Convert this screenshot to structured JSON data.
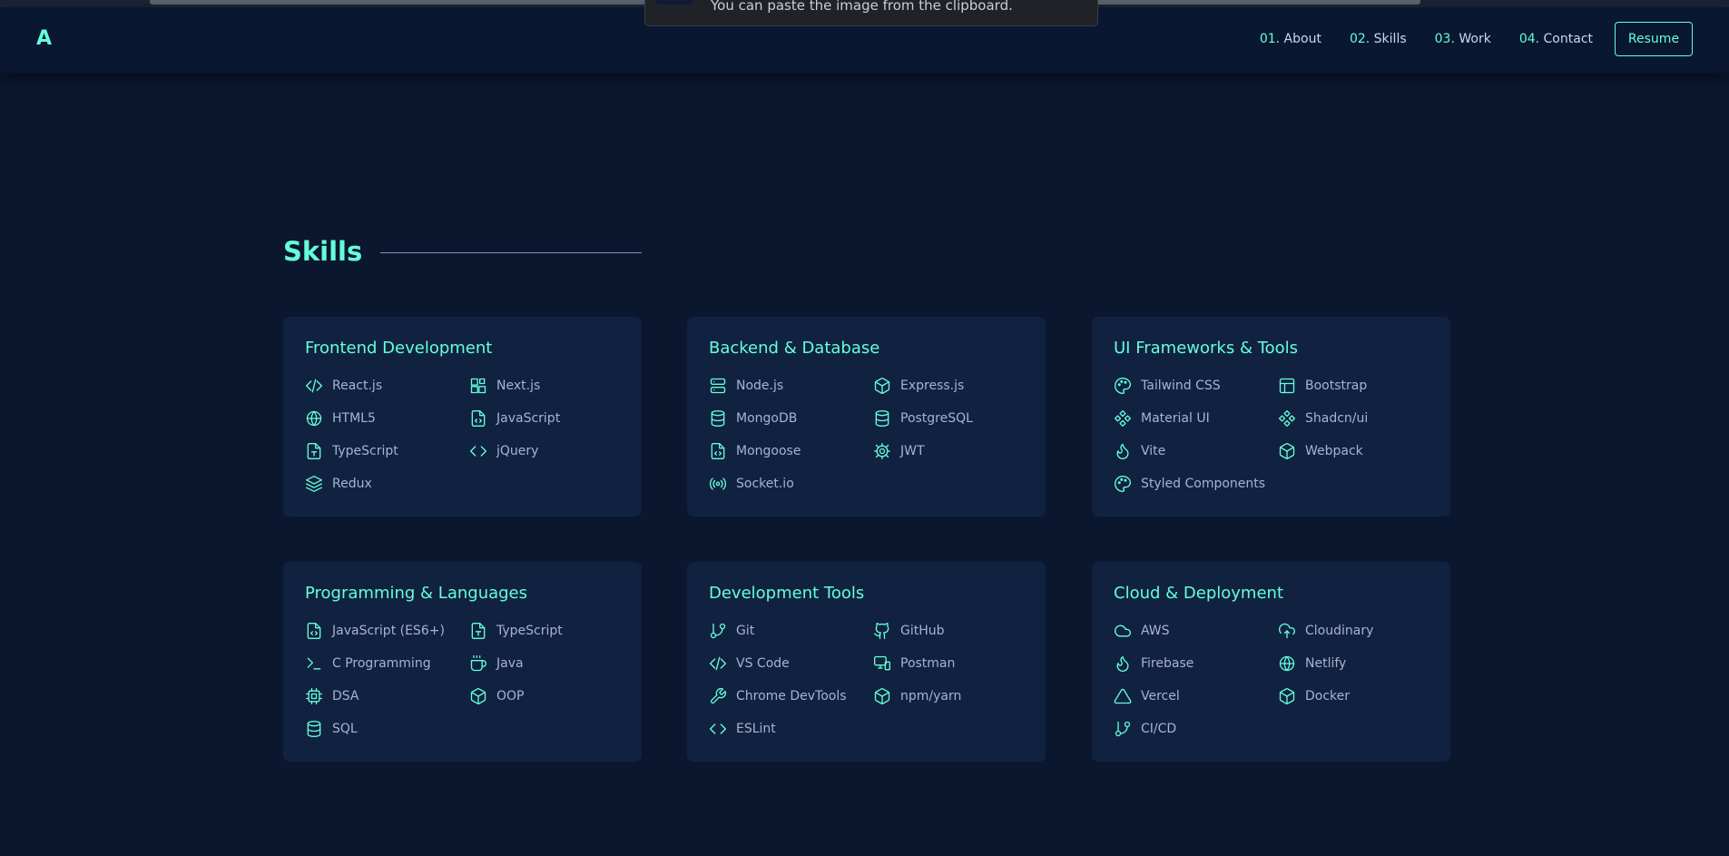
{
  "header": {
    "logo": "A",
    "nav": [
      {
        "num": "01.",
        "label": "About"
      },
      {
        "num": "02.",
        "label": "Skills"
      },
      {
        "num": "03.",
        "label": "Work"
      },
      {
        "num": "04.",
        "label": "Contact"
      }
    ],
    "resume_label": "Resume"
  },
  "toast": {
    "text": "You can paste the image from the clipboard."
  },
  "section": {
    "title": "Skills"
  },
  "cards": [
    {
      "title": "Frontend Development",
      "items": [
        {
          "label": "React.js",
          "icon": "code-icon"
        },
        {
          "label": "Next.js",
          "icon": "blocks-icon"
        },
        {
          "label": "HTML5",
          "icon": "globe-icon"
        },
        {
          "label": "JavaScript",
          "icon": "file-code-icon"
        },
        {
          "label": "TypeScript",
          "icon": "file-type-icon"
        },
        {
          "label": "jQuery",
          "icon": "chevrons-code-icon"
        },
        {
          "label": "Redux",
          "icon": "layers-icon"
        }
      ]
    },
    {
      "title": "Backend & Database",
      "items": [
        {
          "label": "Node.js",
          "icon": "server-icon"
        },
        {
          "label": "Express.js",
          "icon": "package-icon"
        },
        {
          "label": "MongoDB",
          "icon": "database-icon"
        },
        {
          "label": "PostgreSQL",
          "icon": "database-icon"
        },
        {
          "label": "Mongoose",
          "icon": "file-code-icon"
        },
        {
          "label": "JWT",
          "icon": "gear-icon"
        },
        {
          "label": "Socket.io",
          "icon": "radio-icon"
        }
      ]
    },
    {
      "title": "UI Frameworks & Tools",
      "items": [
        {
          "label": "Tailwind CSS",
          "icon": "palette-icon"
        },
        {
          "label": "Bootstrap",
          "icon": "layout-icon"
        },
        {
          "label": "Material UI",
          "icon": "component-icon"
        },
        {
          "label": "Shadcn/ui",
          "icon": "component-icon"
        },
        {
          "label": "Vite",
          "icon": "flame-icon"
        },
        {
          "label": "Webpack",
          "icon": "package-icon"
        },
        {
          "label": "Styled Components",
          "icon": "palette-icon"
        }
      ]
    },
    {
      "title": "Programming & Languages",
      "items": [
        {
          "label": "JavaScript (ES6+)",
          "icon": "file-code-icon"
        },
        {
          "label": "TypeScript",
          "icon": "file-type-icon"
        },
        {
          "label": "C Programming",
          "icon": "terminal-icon"
        },
        {
          "label": "Java",
          "icon": "coffee-icon"
        },
        {
          "label": "DSA",
          "icon": "cpu-icon"
        },
        {
          "label": "OOP",
          "icon": "package-icon"
        },
        {
          "label": "SQL",
          "icon": "database-icon"
        }
      ]
    },
    {
      "title": "Development Tools",
      "items": [
        {
          "label": "Git",
          "icon": "git-branch-icon"
        },
        {
          "label": "GitHub",
          "icon": "github-icon"
        },
        {
          "label": "VS Code",
          "icon": "code-icon"
        },
        {
          "label": "Postman",
          "icon": "monitor-icon"
        },
        {
          "label": "Chrome DevTools",
          "icon": "wrench-icon"
        },
        {
          "label": "npm/yarn",
          "icon": "package-icon"
        },
        {
          "label": "ESLint",
          "icon": "chevrons-code-icon"
        }
      ]
    },
    {
      "title": "Cloud & Deployment",
      "items": [
        {
          "label": "AWS",
          "icon": "cloud-icon"
        },
        {
          "label": "Cloudinary",
          "icon": "cloud-upload-icon"
        },
        {
          "label": "Firebase",
          "icon": "flame-icon"
        },
        {
          "label": "Netlify",
          "icon": "globe-icon"
        },
        {
          "label": "Vercel",
          "icon": "triangle-icon"
        },
        {
          "label": "Docker",
          "icon": "package-icon"
        },
        {
          "label": "CI/CD",
          "icon": "git-branch-icon"
        }
      ]
    }
  ],
  "colors": {
    "accent": "#64ffda",
    "background": "#0b172f",
    "card": "#112240",
    "text": "#a8b2d1"
  }
}
